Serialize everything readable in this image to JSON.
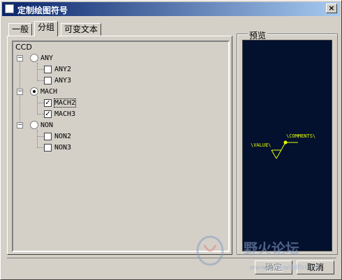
{
  "window": {
    "title": "定制绘图符号",
    "close_label": "×"
  },
  "tabs": [
    {
      "label": "一般"
    },
    {
      "label": "分组"
    },
    {
      "label": "可变文本"
    }
  ],
  "tree": {
    "root_label": "CCD",
    "groups": [
      {
        "label": "ANY",
        "selected": false,
        "children": [
          {
            "label": "ANY2",
            "checked": false
          },
          {
            "label": "ANY3",
            "checked": false
          }
        ]
      },
      {
        "label": "MACH",
        "selected": true,
        "children": [
          {
            "label": "MACH2",
            "checked": true
          },
          {
            "label": "MACH3",
            "checked": true
          }
        ]
      },
      {
        "label": "NON",
        "selected": false,
        "children": [
          {
            "label": "NON2",
            "checked": false
          },
          {
            "label": "NON3",
            "checked": false
          }
        ]
      }
    ]
  },
  "preview": {
    "label": "预览",
    "value_text": "\\VALUE\\",
    "comments_text": "\\COMMENTS\\",
    "symbol_color": "#e6ff00",
    "background_color": "#03102e"
  },
  "buttons": {
    "ok": "确定",
    "cancel": "取消"
  },
  "watermark": {
    "text": "野火论坛",
    "subtext": "www.proewildfire.cn"
  }
}
